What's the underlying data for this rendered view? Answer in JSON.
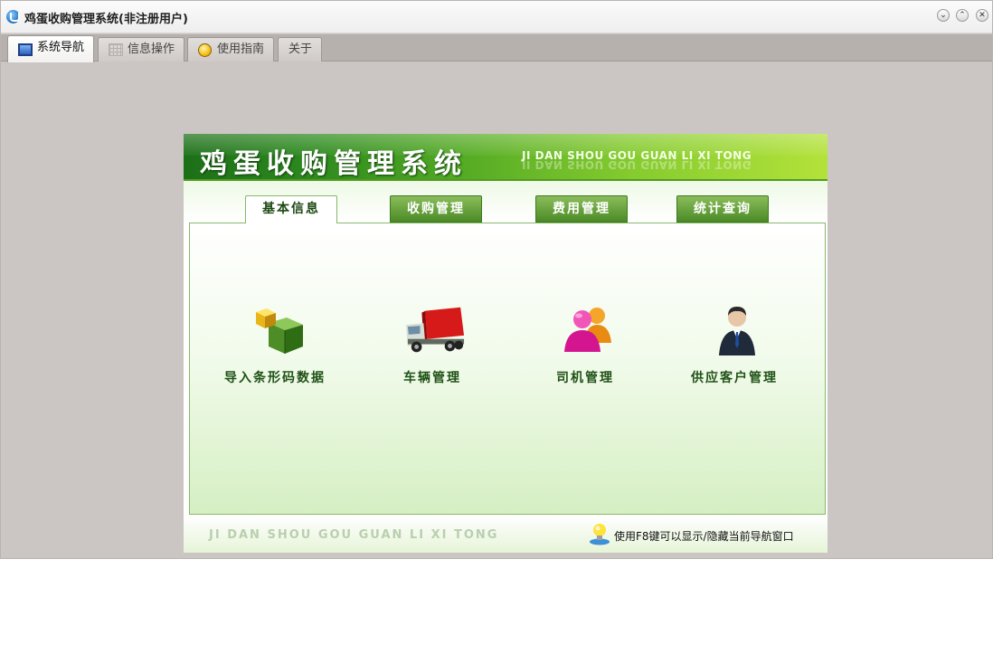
{
  "window": {
    "title": "鸡蛋收购管理系统(非注册用户)"
  },
  "controls": {
    "minimize": "⌄",
    "restore": "⌃",
    "close": "✕"
  },
  "tabs": [
    {
      "label": "系统导航",
      "icon": "monitor-icon",
      "active": true
    },
    {
      "label": "信息操作",
      "icon": "grid-icon",
      "active": false
    },
    {
      "label": "使用指南",
      "icon": "guide-icon",
      "active": false
    },
    {
      "label": "关于",
      "icon": "",
      "active": false
    }
  ],
  "nav": {
    "banner_title": "鸡蛋收购管理系统",
    "banner_subtitle": "JI DAN SHOU GOU GUAN LI XI TONG",
    "categories": [
      {
        "label": "基本信息",
        "active": true
      },
      {
        "label": "收购管理",
        "active": false
      },
      {
        "label": "费用管理",
        "active": false
      },
      {
        "label": "统计查询",
        "active": false
      }
    ],
    "items": [
      {
        "label": "导入条形码数据",
        "icon": "boxes-icon"
      },
      {
        "label": "车辆管理",
        "icon": "truck-icon"
      },
      {
        "label": "司机管理",
        "icon": "users-icon"
      },
      {
        "label": "供应客户管理",
        "icon": "businessman-icon"
      }
    ],
    "footer_text": "JI DAN SHOU GOU GUAN LI XI TONG",
    "footer_hint": "使用F8键可以显示/隐藏当前导航窗口"
  },
  "colors": {
    "accent": "#3a8a1c",
    "banner_end": "#b3e23a",
    "frame": "#cbc6c3"
  }
}
